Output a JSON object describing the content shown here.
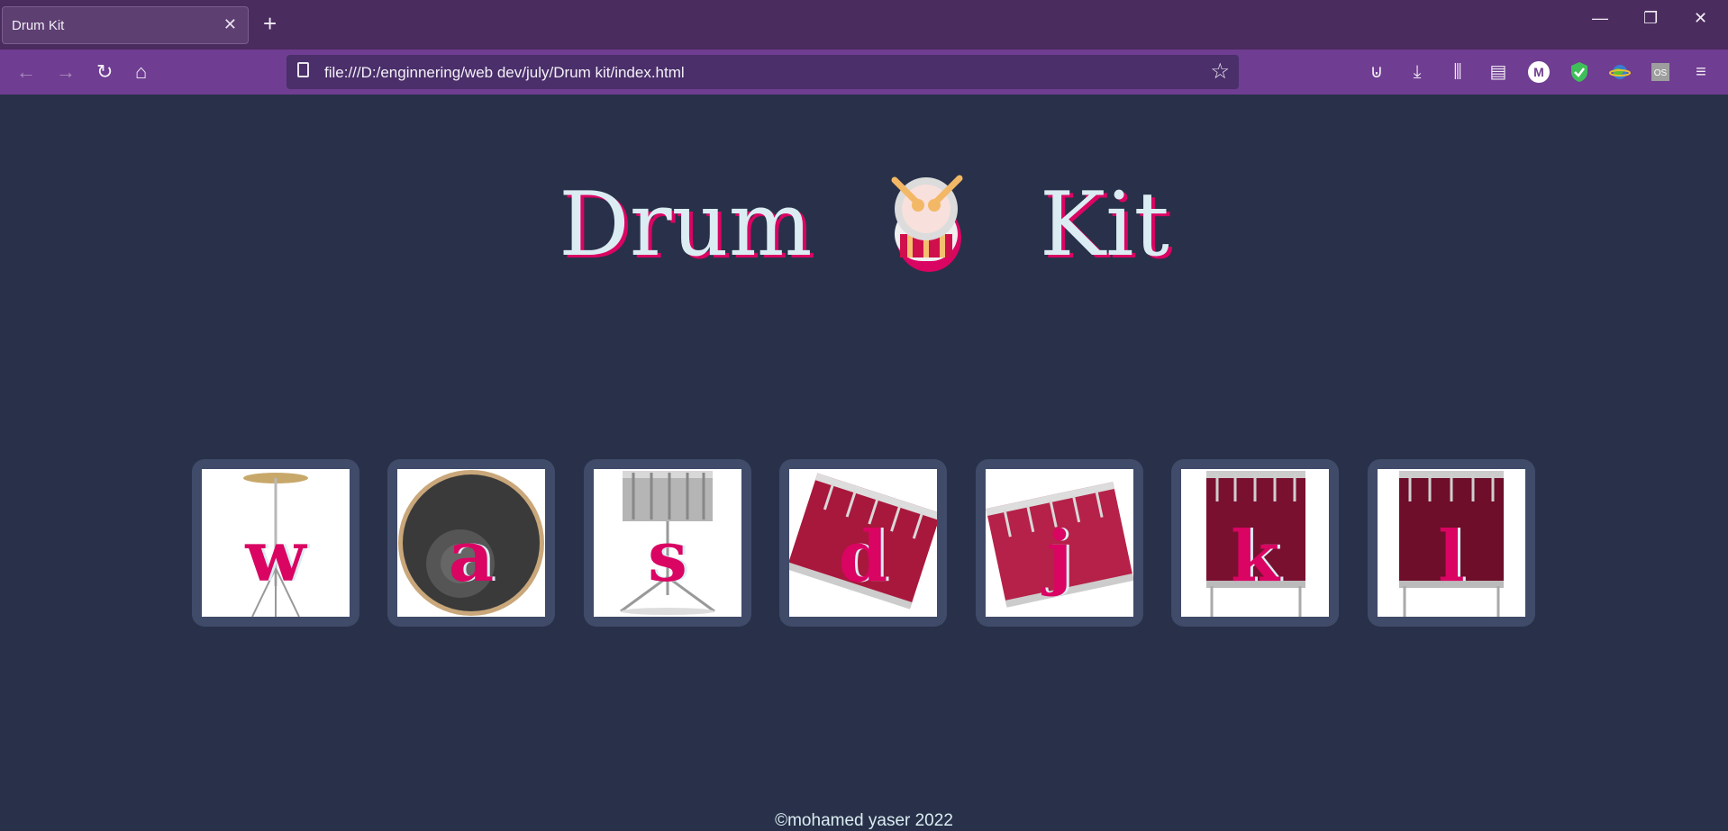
{
  "browser": {
    "tab_title": "Drum Kit",
    "url": "file:///D:/enginnering/web dev/july/Drum kit/index.html",
    "icons": [
      "back-icon",
      "forward-icon",
      "reload-icon",
      "home-icon",
      "pocket-icon",
      "download-icon",
      "library-icon",
      "sidebar-icon",
      "profile-m-icon",
      "shield-extension-icon",
      "globe-extension-icon",
      "os-extension-icon",
      "menu-icon"
    ]
  },
  "page": {
    "title_left": "Drum",
    "title_right": "Kit",
    "pads": [
      {
        "key": "w",
        "instrument": "crash-cymbal"
      },
      {
        "key": "a",
        "instrument": "kick-drum"
      },
      {
        "key": "s",
        "instrument": "snare-drum"
      },
      {
        "key": "d",
        "instrument": "tom-1"
      },
      {
        "key": "j",
        "instrument": "tom-2"
      },
      {
        "key": "k",
        "instrument": "tom-3"
      },
      {
        "key": "l",
        "instrument": "tom-4"
      }
    ],
    "footer": "©mohamed yaser 2022"
  },
  "colors": {
    "background": "#283149",
    "pad": "#404b69",
    "accent": "#da0463",
    "text": "#dbedf3"
  }
}
